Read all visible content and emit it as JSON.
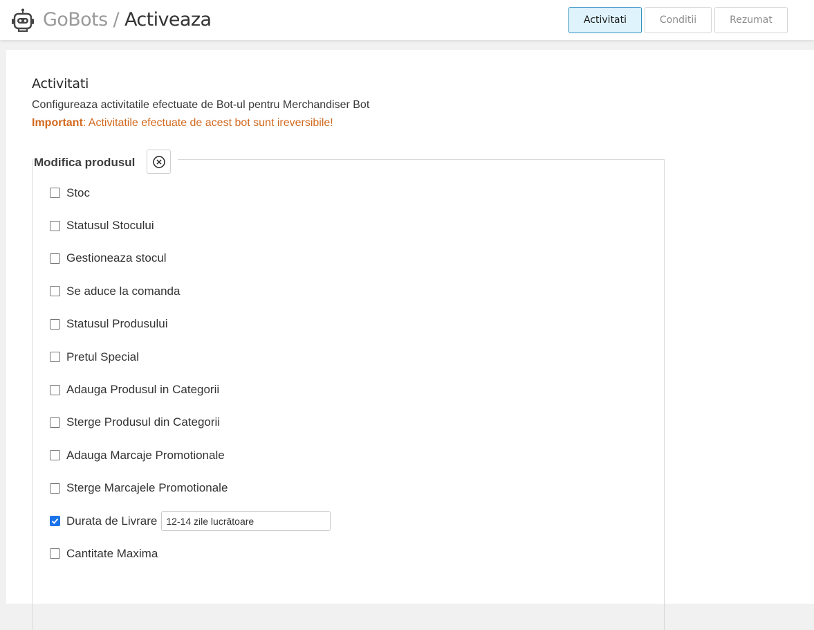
{
  "header": {
    "brand": "GoBots",
    "separator": "/",
    "page": "Activeaza",
    "icon": "robot-icon",
    "steps": [
      {
        "label": "Activitati",
        "active": true
      },
      {
        "label": "Conditii",
        "active": false
      },
      {
        "label": "Rezumat",
        "active": false
      }
    ]
  },
  "section": {
    "title": "Activitati",
    "description": "Configureaza activitatile efectuate de Bot-ul pentru Merchandiser Bot",
    "warning_label": "Important",
    "warning_text": ": Activitatile efectuate de acest bot sunt ireversibile!"
  },
  "group": {
    "legend": "Modifica produsul",
    "remove_icon": "circle-x-icon",
    "items": [
      {
        "label": "Stoc",
        "checked": false
      },
      {
        "label": "Statusul Stocului",
        "checked": false
      },
      {
        "label": "Gestioneaza stocul",
        "checked": false
      },
      {
        "label": "Se aduce la comanda",
        "checked": false
      },
      {
        "label": "Statusul Produsului",
        "checked": false
      },
      {
        "label": "Pretul Special",
        "checked": false
      },
      {
        "label": "Adauga Produsul in Categorii",
        "checked": false
      },
      {
        "label": "Sterge Produsul din Categorii",
        "checked": false
      },
      {
        "label": "Adauga Marcaje Promotionale",
        "checked": false
      },
      {
        "label": "Sterge Marcajele Promotionale",
        "checked": false
      },
      {
        "label": "Durata de Livrare",
        "checked": true,
        "input_value": "12-14 zile lucrătoare"
      },
      {
        "label": "Cantitate Maxima",
        "checked": false
      }
    ]
  },
  "colors": {
    "accent": "#2c8fbf",
    "active_step_bg": "#dff3fd",
    "warning": "#d2691e",
    "checkbox_checked": "#1a73e8"
  }
}
